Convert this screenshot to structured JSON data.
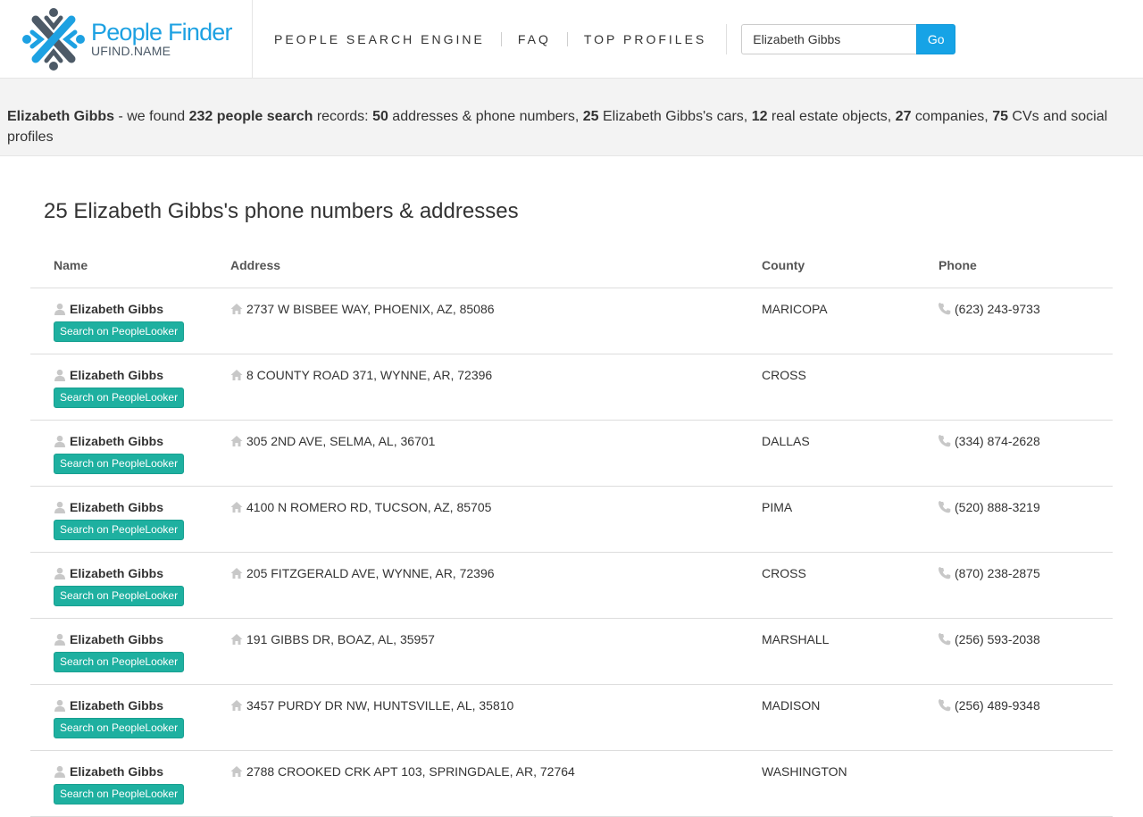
{
  "brand": {
    "title": "People Finder",
    "subtitle": "UFIND.NAME",
    "colors": {
      "blue": "#1da1e2",
      "slate": "#4a5866"
    }
  },
  "nav": {
    "items": [
      {
        "label": "PEOPLE SEARCH ENGINE"
      },
      {
        "label": "FAQ"
      },
      {
        "label": "TOP PROFILES"
      }
    ]
  },
  "search": {
    "value": "Elizabeth Gibbs",
    "button_label": "Go"
  },
  "summary": {
    "name": "Elizabeth Gibbs",
    "text_1": " - we found ",
    "people_count": "232 people search",
    "text_2": " records: ",
    "addresses_count": "50",
    "text_3": " addresses & phone numbers, ",
    "cars_count": "25",
    "text_4": " Elizabeth Gibbs's cars, ",
    "realestate_count": "12",
    "text_5": " real estate objects, ",
    "companies_count": "27",
    "text_6": " companies, ",
    "cvs_count": "75",
    "text_7": " CVs and social profiles"
  },
  "section": {
    "title": "25 Elizabeth Gibbs's phone numbers & addresses"
  },
  "table": {
    "headers": {
      "name": "Name",
      "address": "Address",
      "county": "County",
      "phone": "Phone"
    },
    "button_label": "Search on PeopleLooker",
    "icons": {
      "person": "person-icon",
      "home": "home-icon",
      "phone": "phone-icon"
    },
    "button_color": "#1eb0a0",
    "rows": [
      {
        "name": "Elizabeth Gibbs",
        "address": "2737 W BISBEE WAY, PHOENIX, AZ, 85086",
        "county": "MARICOPA",
        "phone": "(623) 243-9733"
      },
      {
        "name": "Elizabeth Gibbs",
        "address": "8 COUNTY ROAD 371, WYNNE, AR, 72396",
        "county": "CROSS",
        "phone": ""
      },
      {
        "name": "Elizabeth Gibbs",
        "address": "305 2ND AVE, SELMA, AL, 36701",
        "county": "DALLAS",
        "phone": "(334) 874-2628"
      },
      {
        "name": "Elizabeth Gibbs",
        "address": "4100 N ROMERO RD, TUCSON, AZ, 85705",
        "county": "PIMA",
        "phone": "(520) 888-3219"
      },
      {
        "name": "Elizabeth Gibbs",
        "address": "205 FITZGERALD AVE, WYNNE, AR, 72396",
        "county": "CROSS",
        "phone": "(870) 238-2875"
      },
      {
        "name": "Elizabeth Gibbs",
        "address": "191 GIBBS DR, BOAZ, AL, 35957",
        "county": "MARSHALL",
        "phone": "(256) 593-2038"
      },
      {
        "name": "Elizabeth Gibbs",
        "address": "3457 PURDY DR NW, HUNTSVILLE, AL, 35810",
        "county": "MADISON",
        "phone": "(256) 489-9348"
      },
      {
        "name": "Elizabeth Gibbs",
        "address": "2788 CROOKED CRK APT 103, SPRINGDALE, AR, 72764",
        "county": "WASHINGTON",
        "phone": ""
      }
    ]
  }
}
